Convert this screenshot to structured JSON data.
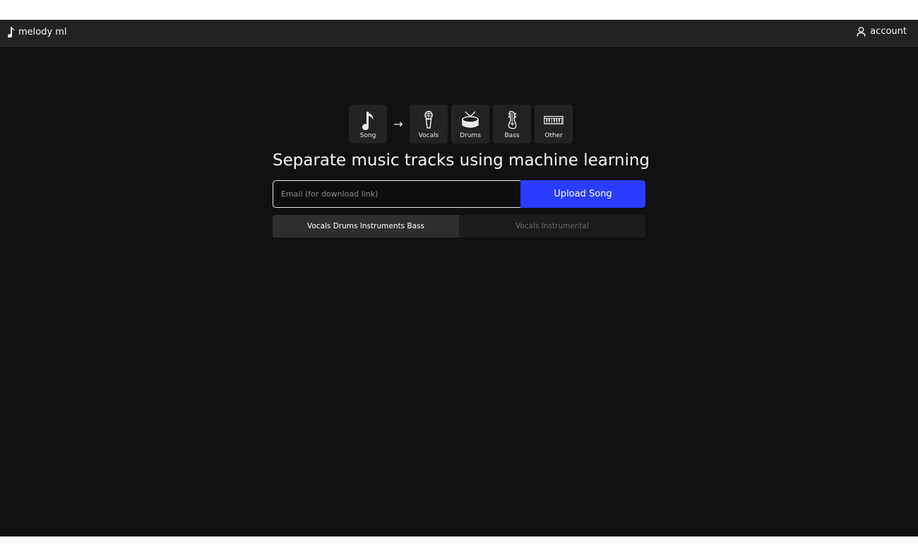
{
  "nav": {
    "brand": "melody ml",
    "brand_icon": "music-note-icon",
    "account_label": "account",
    "account_icon": "user-icon"
  },
  "stems": {
    "source": {
      "label": "Song",
      "icon": "music-note-icon"
    },
    "arrow": "→",
    "outputs": [
      {
        "label": "Vocals",
        "icon": "microphone-icon"
      },
      {
        "label": "Drums",
        "icon": "drum-icon"
      },
      {
        "label": "Bass",
        "icon": "bass-guitar-icon"
      },
      {
        "label": "Other",
        "icon": "keyboard-icon"
      }
    ]
  },
  "headline": "Separate music tracks using machine learning",
  "form": {
    "email_placeholder": "Email (for download link)",
    "email_value": "",
    "upload_label": "Upload Song"
  },
  "modes": [
    {
      "label": "Vocals Drums Instruments Bass",
      "selected": true
    },
    {
      "label": "Vocals Instrumental",
      "selected": false
    }
  ],
  "colors": {
    "background": "#111111",
    "navbar": "#222224",
    "accent": "#2a3cff",
    "text": "#f5f5f5"
  }
}
